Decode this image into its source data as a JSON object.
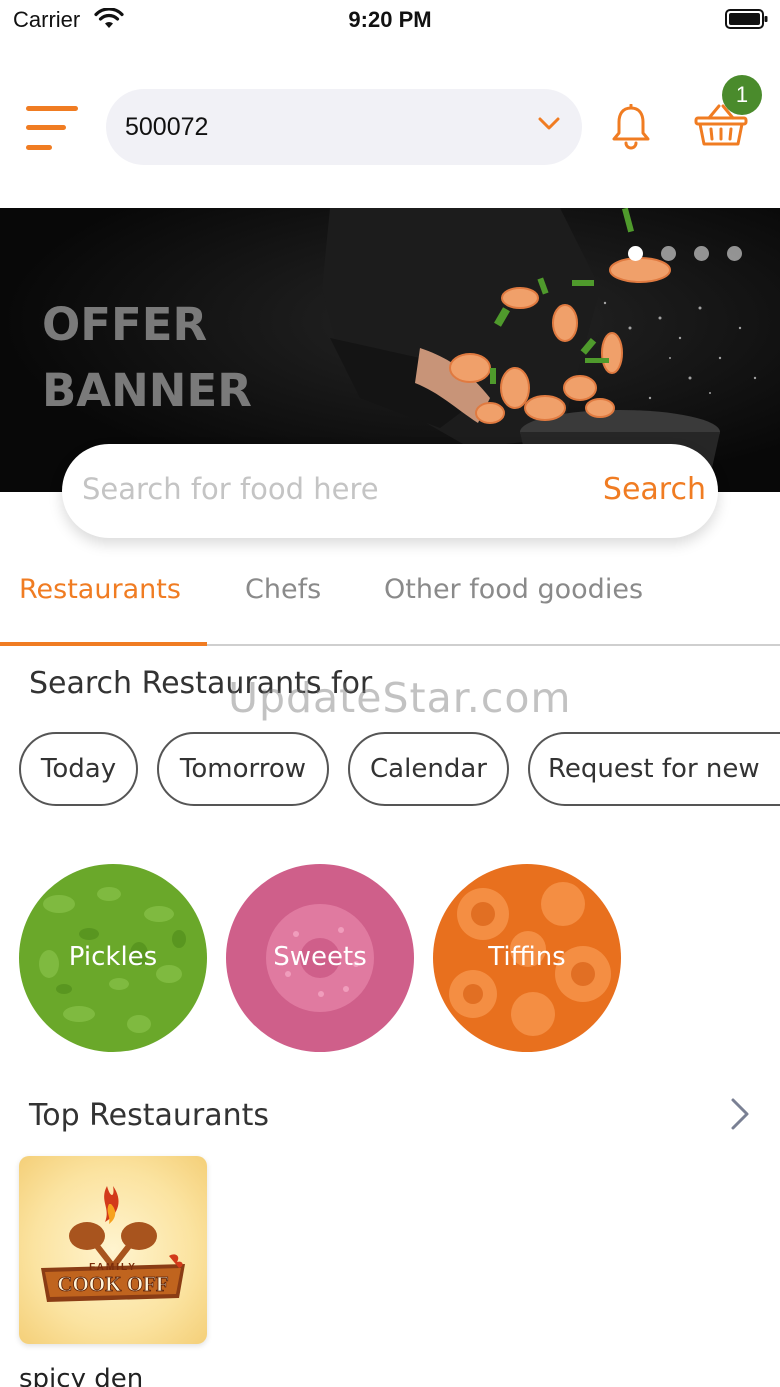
{
  "status_bar": {
    "carrier": "Carrier",
    "time": "9:20 PM"
  },
  "header": {
    "location_value": "500072",
    "cart_count": "1"
  },
  "banner": {
    "title": "OFFER BANNER",
    "slide_count": 4,
    "active_slide": 1
  },
  "search": {
    "placeholder": "Search for food here",
    "button_label": "Search"
  },
  "tabs": [
    {
      "label": "Restaurants",
      "active": true
    },
    {
      "label": "Chefs",
      "active": false
    },
    {
      "label": "Other food goodies",
      "active": false
    }
  ],
  "restaurants_search": {
    "title": "Search Restaurants for",
    "chips": [
      "Today",
      "Tomorrow",
      "Calendar",
      "Request for new"
    ]
  },
  "watermark": "UpdateStar.com",
  "categories": [
    {
      "label": "Pickles",
      "color": "#6aa82a"
    },
    {
      "label": "Sweets",
      "color": "#cf5f8a"
    },
    {
      "label": "Tiffins",
      "color": "#e8701e"
    }
  ],
  "top_restaurants": {
    "title": "Top Restaurants",
    "items": [
      {
        "name": "spicy den",
        "logo_text": "COOK OFF",
        "logo_subtext": "FAMILY"
      }
    ]
  },
  "colors": {
    "accent": "#f07c22",
    "badge": "#4a8b2c"
  }
}
